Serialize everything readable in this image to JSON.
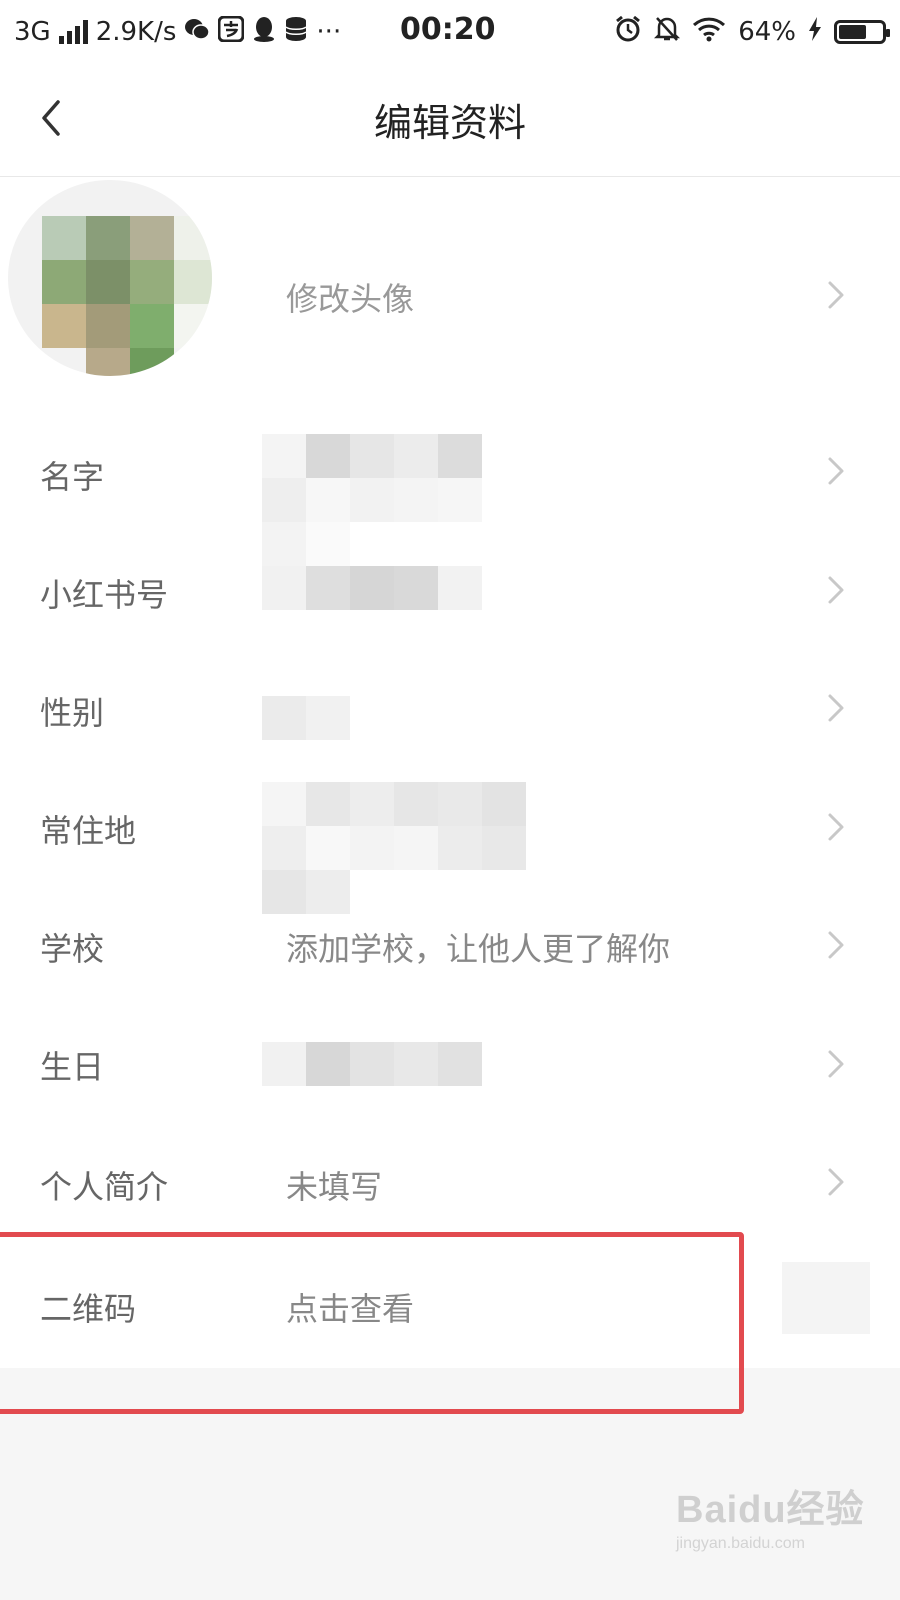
{
  "status_bar": {
    "network": "3G",
    "speed": "2.9K/s",
    "more": "···",
    "time": "00:20",
    "battery_percent": "64%",
    "battery_level": 0.64,
    "icons": [
      "wechat-icon",
      "alipay-icon",
      "qq-icon",
      "storage-icon",
      "alarm-icon",
      "mute-icon",
      "wifi-icon",
      "charging-icon"
    ]
  },
  "header": {
    "title": "编辑资料",
    "back_icon": "back-arrow-icon"
  },
  "rows": {
    "avatar": {
      "value": "修改头像"
    },
    "name": {
      "label": "名字"
    },
    "red_id": {
      "label": "小红书号"
    },
    "gender": {
      "label": "性别"
    },
    "residence": {
      "label": "常住地"
    },
    "school": {
      "label": "学校",
      "value": "添加学校，让他人更了解你"
    },
    "birthday": {
      "label": "生日"
    },
    "bio": {
      "label": "个人简介",
      "value": "未填写"
    },
    "qrcode": {
      "label": "二维码",
      "value": "点击查看"
    }
  },
  "colors": {
    "highlight_border": "#e24a4f",
    "label_text": "#666666",
    "value_text": "#888888",
    "chevron": "#c8c8c8"
  },
  "watermark": {
    "logo": "Baidu经验",
    "url": "jingyan.baidu.com"
  }
}
